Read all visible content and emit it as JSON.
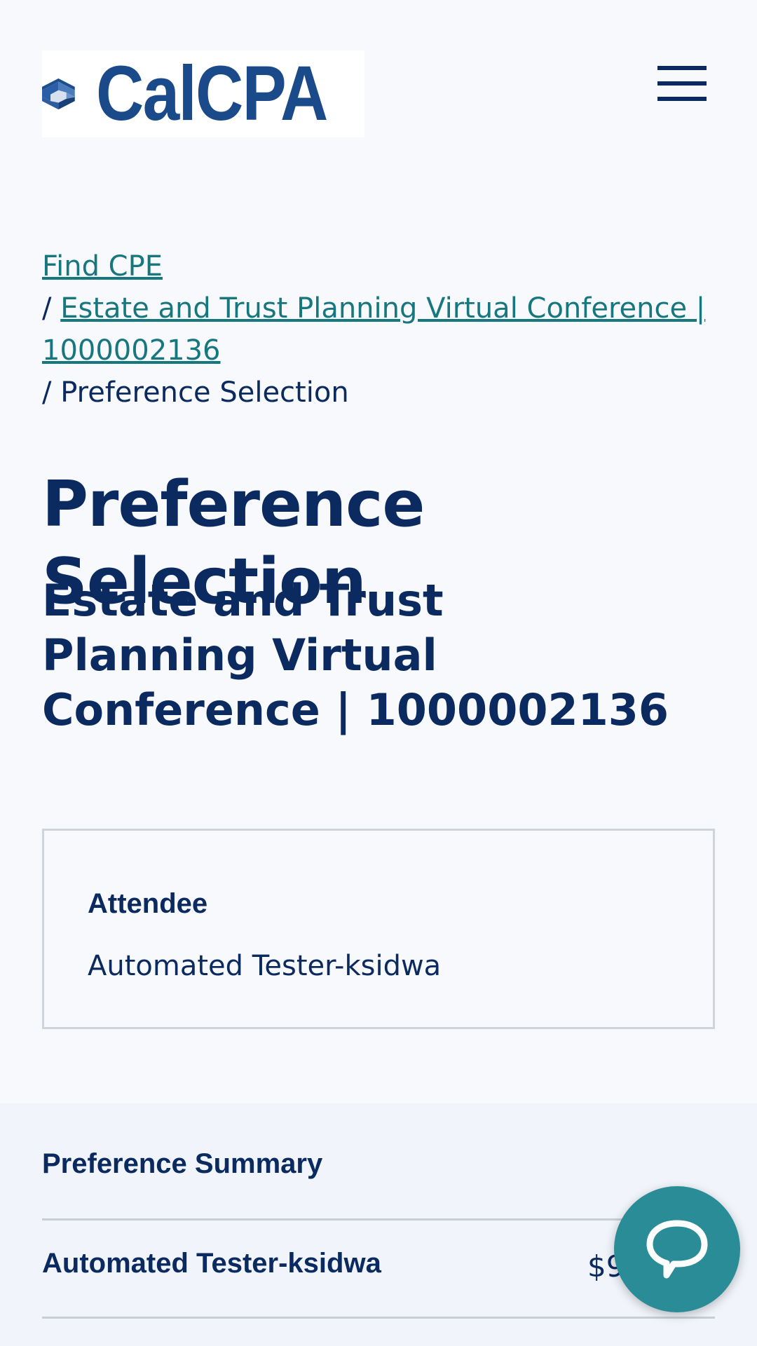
{
  "header": {
    "logo_text": "CalCPA",
    "menu_icon": "hamburger-menu-icon"
  },
  "breadcrumb": {
    "items": [
      {
        "label": "Find CPE"
      },
      {
        "label": "Estate and Trust Planning Virtual Conference | 1000002136"
      },
      {
        "label": "Preference Selection"
      }
    ],
    "separator": "/"
  },
  "page": {
    "title": "Preference Selection",
    "event_title": "Estate and Trust Planning Virtual Conference | 1000002136"
  },
  "attendee": {
    "label": "Attendee",
    "name": "Automated Tester-ksidwa"
  },
  "summary": {
    "title": "Preference Summary",
    "rows": [
      {
        "name": "Automated Tester-ksidwa",
        "price_visible": "$9"
      }
    ]
  },
  "chat": {
    "icon": "chat-bubble-icon"
  },
  "colors": {
    "navy": "#0b2a60",
    "link_teal": "#17777e",
    "chat_teal": "#2a8c96",
    "logo_blue": "#1a4a8a"
  }
}
